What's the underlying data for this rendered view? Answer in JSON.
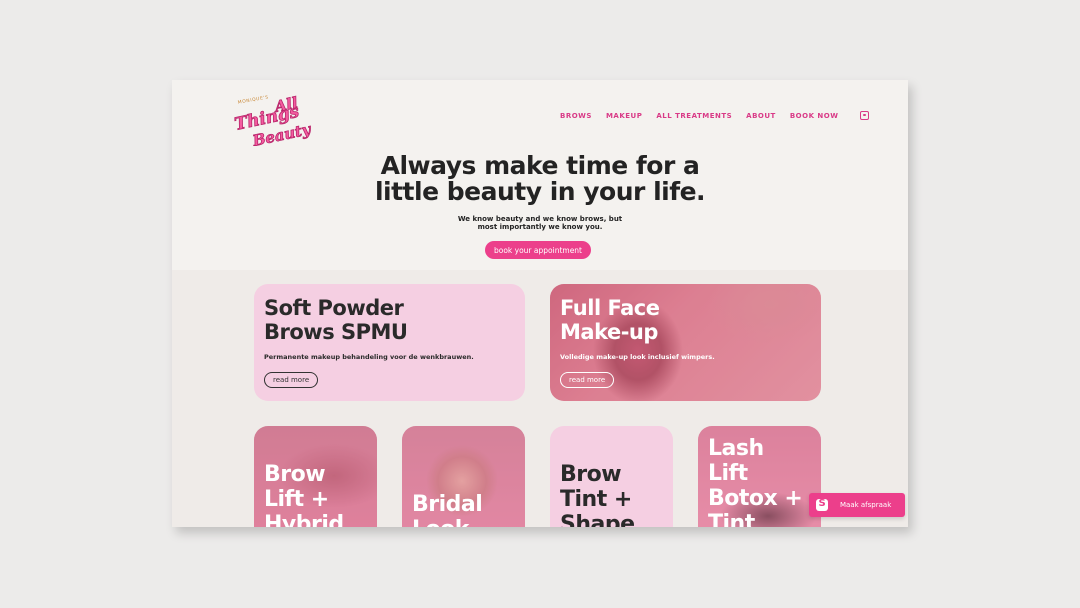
{
  "nav": {
    "items": [
      "BROWS",
      "MAKEUP",
      "ALL TREATMENTS",
      "ABOUT",
      "BOOK NOW"
    ],
    "instagram_icon": "instagram-icon"
  },
  "logo": {
    "small_text": "MONIQUE'S",
    "line1": "All",
    "line2": "Things",
    "line3": "Beauty"
  },
  "hero": {
    "title_line1": "Always make time for a",
    "title_line2": "little beauty in your life.",
    "sub_line1": "We know beauty and we know brows, but",
    "sub_line2": "most importantly we know you.",
    "button": "book your appointment"
  },
  "cards_large": [
    {
      "title_line1": "Soft Powder",
      "title_line2": "Brows SPMU",
      "desc": "Permanente makeup behandeling voor de wenkbrauwen.",
      "more": "read more"
    },
    {
      "title_line1": "Full Face",
      "title_line2": "Make-up",
      "desc": "Volledige make-up look inclusief wimpers.",
      "more": "read more"
    }
  ],
  "cards_small": [
    {
      "lines": [
        "Brow",
        "Lift +",
        "Hybrid"
      ]
    },
    {
      "lines": [
        "Bridal",
        "Look"
      ]
    },
    {
      "lines": [
        "Brow",
        "Tint +",
        "Shape"
      ]
    },
    {
      "lines": [
        "Lash",
        "Lift",
        "Botox +",
        "Tint"
      ]
    }
  ],
  "chat": {
    "label": "Maak afspraak"
  },
  "colors": {
    "accent": "#ec3f8b",
    "card_pink": "#f5cfe2",
    "page_bg": "#f4f2ef"
  }
}
